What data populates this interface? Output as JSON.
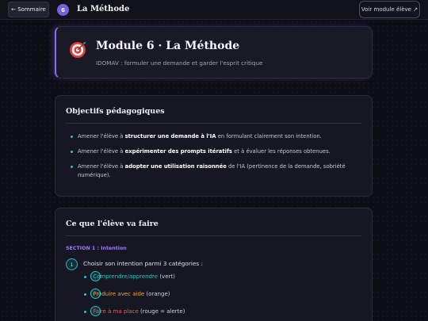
{
  "topbar": {
    "back_label": "← Sommaire",
    "module_number": "6",
    "title": "La Méthode",
    "view_student_label": "Voir module élève ↗"
  },
  "hero": {
    "icon": "target-icon",
    "title": "Module 6 · La Méthode",
    "subtitle": "IDOMAV : formuler une demande et garder l'esprit critique"
  },
  "objectives": {
    "title": "Objectifs pédagogiques",
    "items": [
      {
        "pre": "Amener l'élève à ",
        "bold": "structurer une demande à l'IA",
        "post": " en formulant clairement son intention."
      },
      {
        "pre": "Amener l'élève à ",
        "bold": "expérimenter des prompts itératifs",
        "post": " et à évaluer les réponses obtenues."
      },
      {
        "pre": "Amener l'élève à ",
        "bold": "adopter une utilisation raisonnée",
        "post": " de l'IA (pertinence de la demande, sobriété numérique)."
      }
    ]
  },
  "activities": {
    "title": "Ce que l'élève va faire",
    "section_label": "SECTION 1 : Intention",
    "step_number": "1",
    "step_text": "Choisir son intention parmi 3 catégories :",
    "categories": [
      {
        "label": "Comprendre/apprendre",
        "note": " (vert)",
        "color": "#22c7c7"
      },
      {
        "label": "Produire avec aide",
        "note": " (orange)",
        "color": "#f0a040"
      },
      {
        "label": "Faire à ma place",
        "note": " (rouge = alerte)",
        "color": "#ee5a5a"
      }
    ]
  }
}
